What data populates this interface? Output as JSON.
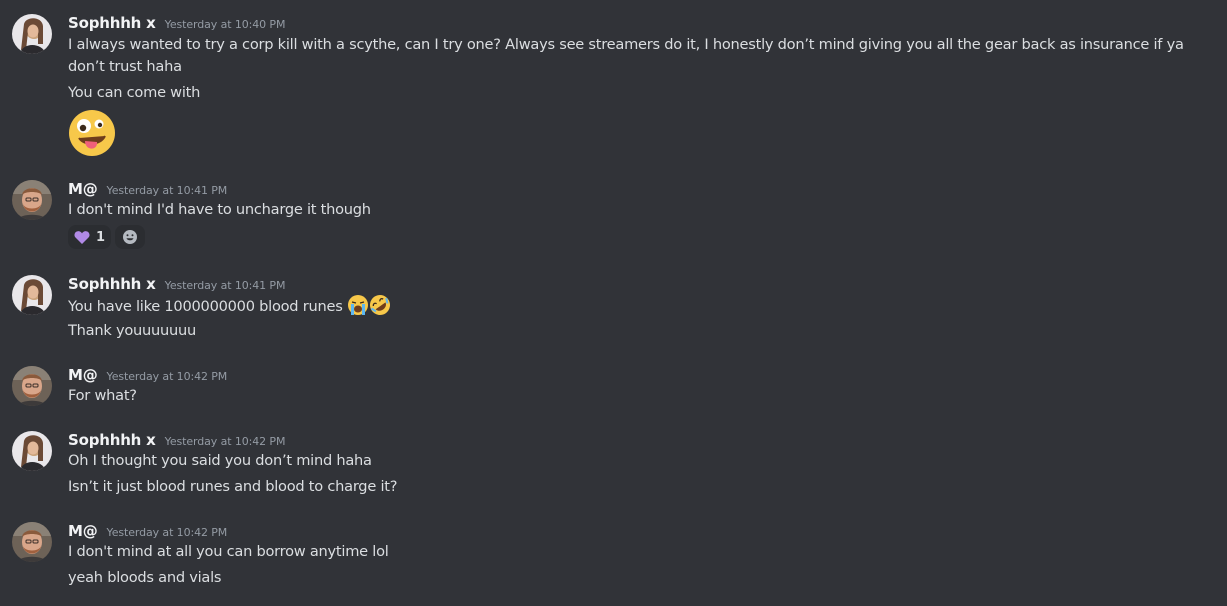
{
  "users": {
    "sophie": {
      "name": "Sophhhh x"
    },
    "matt": {
      "name": "M@"
    }
  },
  "messages": [
    {
      "author": "Sophhhh x",
      "timestamp": "Yesterday at 10:40 PM",
      "lines": [
        "I always wanted to try a corp kill with a scythe, can I try one? Always see streamers do it, I honestly don’t mind giving you all the gear back as insurance if ya don’t trust haha",
        "You can come with"
      ],
      "emoji": "zany-face"
    },
    {
      "author": "M@",
      "timestamp": "Yesterday at 10:41 PM",
      "lines": [
        "I don't mind I'd have to uncharge it though"
      ],
      "reactions": [
        {
          "emoji": "purple-heart",
          "count": "1"
        }
      ]
    },
    {
      "author": "Sophhhh x",
      "timestamp": "Yesterday at 10:41 PM",
      "lines": [
        "You have like 1000000000 blood runes",
        "Thank youuuuuuu"
      ],
      "inline_emojis": [
        "loudly-crying-face",
        "rolling-on-floor-laughing"
      ]
    },
    {
      "author": "M@",
      "timestamp": "Yesterday at 10:42 PM",
      "lines": [
        "For what?"
      ]
    },
    {
      "author": "Sophhhh x",
      "timestamp": "Yesterday at 10:42 PM",
      "lines": [
        "Oh I thought you said you don’t mind haha",
        "Isn’t it just blood runes and blood to charge it?"
      ]
    },
    {
      "author": "M@",
      "timestamp": "Yesterday at 10:42 PM",
      "lines": [
        "I don't mind at all you can borrow anytime lol",
        "yeah bloods and vials"
      ]
    }
  ],
  "colors": {
    "background": "#313338",
    "text": "#dbdee1",
    "author": "#f2f3f5",
    "timestamp": "#949ba4",
    "reaction_bg": "#2b2d31"
  }
}
